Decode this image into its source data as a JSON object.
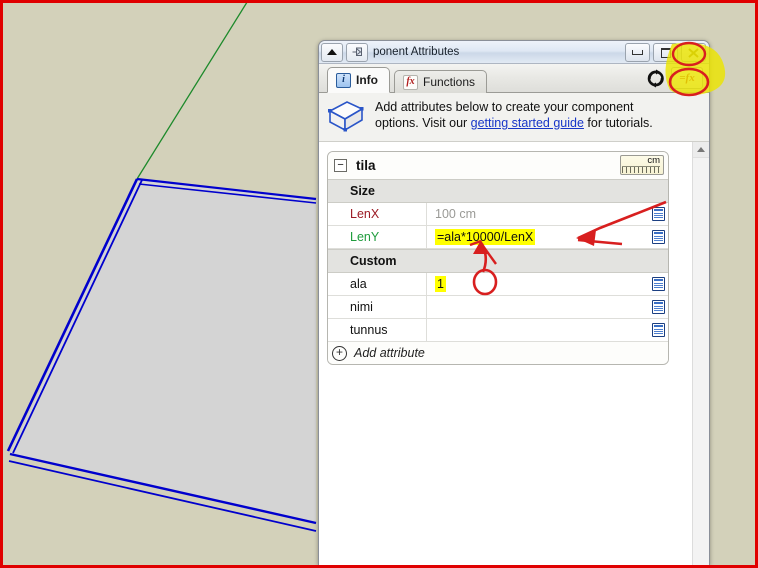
{
  "window": {
    "title": "ponent Attributes",
    "expand_icon": "triangle-up-icon",
    "pin_icon": "pin-icon",
    "minimize_label": "minimize",
    "restore_label": "restore",
    "close_label": "close"
  },
  "tabs": [
    {
      "label": "Info",
      "icon": "info-icon",
      "active": true
    },
    {
      "label": "Functions",
      "icon": "fx-icon",
      "active": false
    }
  ],
  "toolbar": {
    "refresh_icon": "refresh-icon",
    "formula_label": "=fx"
  },
  "banner": {
    "icon": "component-box-icon",
    "text_before": "Add attributes below to create your component options. Visit our ",
    "link_text": "getting started guide",
    "text_after": " for tutorials."
  },
  "component": {
    "name": "tila",
    "collapse_symbol": "−",
    "units_label": "cm"
  },
  "attributes": {
    "groups": [
      {
        "title": "Size",
        "rows": [
          {
            "name": "LenX",
            "name_color": "red",
            "value": "100 cm",
            "muted": true,
            "highlight": false
          },
          {
            "name": "LenY",
            "name_color": "green",
            "value": "=ala*10000/LenX",
            "muted": false,
            "highlight": true
          }
        ]
      },
      {
        "title": "Custom",
        "rows": [
          {
            "name": "ala",
            "name_color": "dark",
            "value": "1",
            "muted": false,
            "highlight": true
          },
          {
            "name": "nimi",
            "name_color": "dark",
            "value": "",
            "muted": false,
            "highlight": false
          },
          {
            "name": "tunnus",
            "name_color": "dark",
            "value": "",
            "muted": false,
            "highlight": false
          }
        ]
      }
    ],
    "add_attribute_label": "Add attribute",
    "row_icon": "row-detail-icon",
    "add_icon": "plus-circle-icon"
  },
  "colors": {
    "viewport_background": "#d3d1ba",
    "face_fill": "#d4d4d4",
    "selection_edge": "#0000cd",
    "axis_green": "#1d8a2b",
    "annotation_red": "#d81f1f",
    "highlight_yellow": "#ffff00",
    "capture_border": "#e00000",
    "attr_red": "#9c1b25",
    "attr_green": "#1f9c3d",
    "link_blue": "#1836c8"
  },
  "annotations": {
    "arrow_to_formula": "red-arrow-pointing-to-leny-formula",
    "arrow_from_ala": "red-arrow-from-ala-value-to-formula",
    "circle_ala": "red-circle-around-ala-value",
    "circle_fx_button": "red-circle-around-fx-button",
    "highlight_fx_area": "yellow-highlight-over-toolbar"
  },
  "viewport": {
    "scene_name": "sketchup-3d-viewport",
    "selected_face": "selected-rectangle-face",
    "axis_line": "green-axis-line"
  }
}
